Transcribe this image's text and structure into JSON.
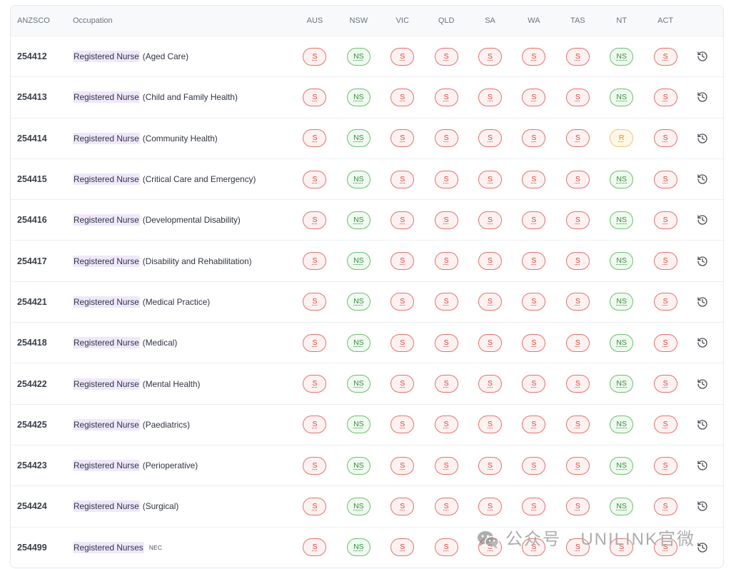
{
  "table": {
    "headers": {
      "code": "ANZSCO",
      "occupation": "Occupation",
      "states": [
        "AUS",
        "NSW",
        "VIC",
        "QLD",
        "SA",
        "WA",
        "TAS",
        "NT",
        "ACT"
      ]
    },
    "rows": [
      {
        "code": "254412",
        "title": "Registered Nurse",
        "specialty": "(Aged Care)",
        "statuses": [
          "S",
          "NS",
          "S",
          "S",
          "S",
          "S",
          "S",
          "NS",
          "S"
        ]
      },
      {
        "code": "254413",
        "title": "Registered Nurse",
        "specialty": "(Child and Family Health)",
        "statuses": [
          "S",
          "NS",
          "S",
          "S",
          "S",
          "S",
          "S",
          "NS",
          "S"
        ]
      },
      {
        "code": "254414",
        "title": "Registered Nurse",
        "specialty": "(Community Health)",
        "statuses": [
          "S",
          "NS",
          "S",
          "S",
          "S",
          "S",
          "S",
          "R",
          "S"
        ]
      },
      {
        "code": "254415",
        "title": "Registered Nurse",
        "specialty": "(Critical Care and Emergency)",
        "statuses": [
          "S",
          "NS",
          "S",
          "S",
          "S",
          "S",
          "S",
          "NS",
          "S"
        ]
      },
      {
        "code": "254416",
        "title": "Registered Nurse",
        "specialty": "(Developmental Disability)",
        "statuses": [
          "S",
          "NS",
          "S",
          "S",
          "S",
          "S",
          "S",
          "NS",
          "S"
        ]
      },
      {
        "code": "254417",
        "title": "Registered Nurse",
        "specialty": "(Disability and Rehabilitation)",
        "statuses": [
          "S",
          "NS",
          "S",
          "S",
          "S",
          "S",
          "S",
          "NS",
          "S"
        ]
      },
      {
        "code": "254421",
        "title": "Registered Nurse",
        "specialty": "(Medical Practice)",
        "statuses": [
          "S",
          "NS",
          "S",
          "S",
          "S",
          "S",
          "S",
          "NS",
          "S"
        ]
      },
      {
        "code": "254418",
        "title": "Registered Nurse",
        "specialty": "(Medical)",
        "statuses": [
          "S",
          "NS",
          "S",
          "S",
          "S",
          "S",
          "S",
          "NS",
          "S"
        ]
      },
      {
        "code": "254422",
        "title": "Registered Nurse",
        "specialty": "(Mental Health)",
        "statuses": [
          "S",
          "NS",
          "S",
          "S",
          "S",
          "S",
          "S",
          "NS",
          "S"
        ]
      },
      {
        "code": "254425",
        "title": "Registered Nurse",
        "specialty": "(Paediatrics)",
        "statuses": [
          "S",
          "NS",
          "S",
          "S",
          "S",
          "S",
          "S",
          "NS",
          "S"
        ]
      },
      {
        "code": "254423",
        "title": "Registered Nurse",
        "specialty": "(Perioperative)",
        "statuses": [
          "S",
          "NS",
          "S",
          "S",
          "S",
          "S",
          "S",
          "NS",
          "S"
        ]
      },
      {
        "code": "254424",
        "title": "Registered Nurse",
        "specialty": "(Surgical)",
        "statuses": [
          "S",
          "NS",
          "S",
          "S",
          "S",
          "S",
          "S",
          "NS",
          "S"
        ]
      },
      {
        "code": "254499",
        "title": "Registered Nurses",
        "tag": "NEC",
        "statuses": [
          "S",
          "NS",
          "S",
          "S",
          "S",
          "S",
          "S",
          "S",
          "S"
        ]
      }
    ]
  },
  "status_styles": {
    "S": {
      "border": "#e2736c",
      "fill": "#fdf2f1",
      "text": "#d6453d"
    },
    "NS": {
      "border": "#6cbf6f",
      "fill": "#effaf0",
      "text": "#3b8a3f"
    },
    "R": {
      "border": "#f3c47a",
      "fill": "#fff7e8",
      "text": "#e08b12"
    }
  },
  "highlight_color": "#efe8fb",
  "icons": {
    "row_action": "history-icon",
    "watermark": "wechat-icon"
  },
  "watermark": {
    "text": "公众号 · UNILINK官微"
  }
}
